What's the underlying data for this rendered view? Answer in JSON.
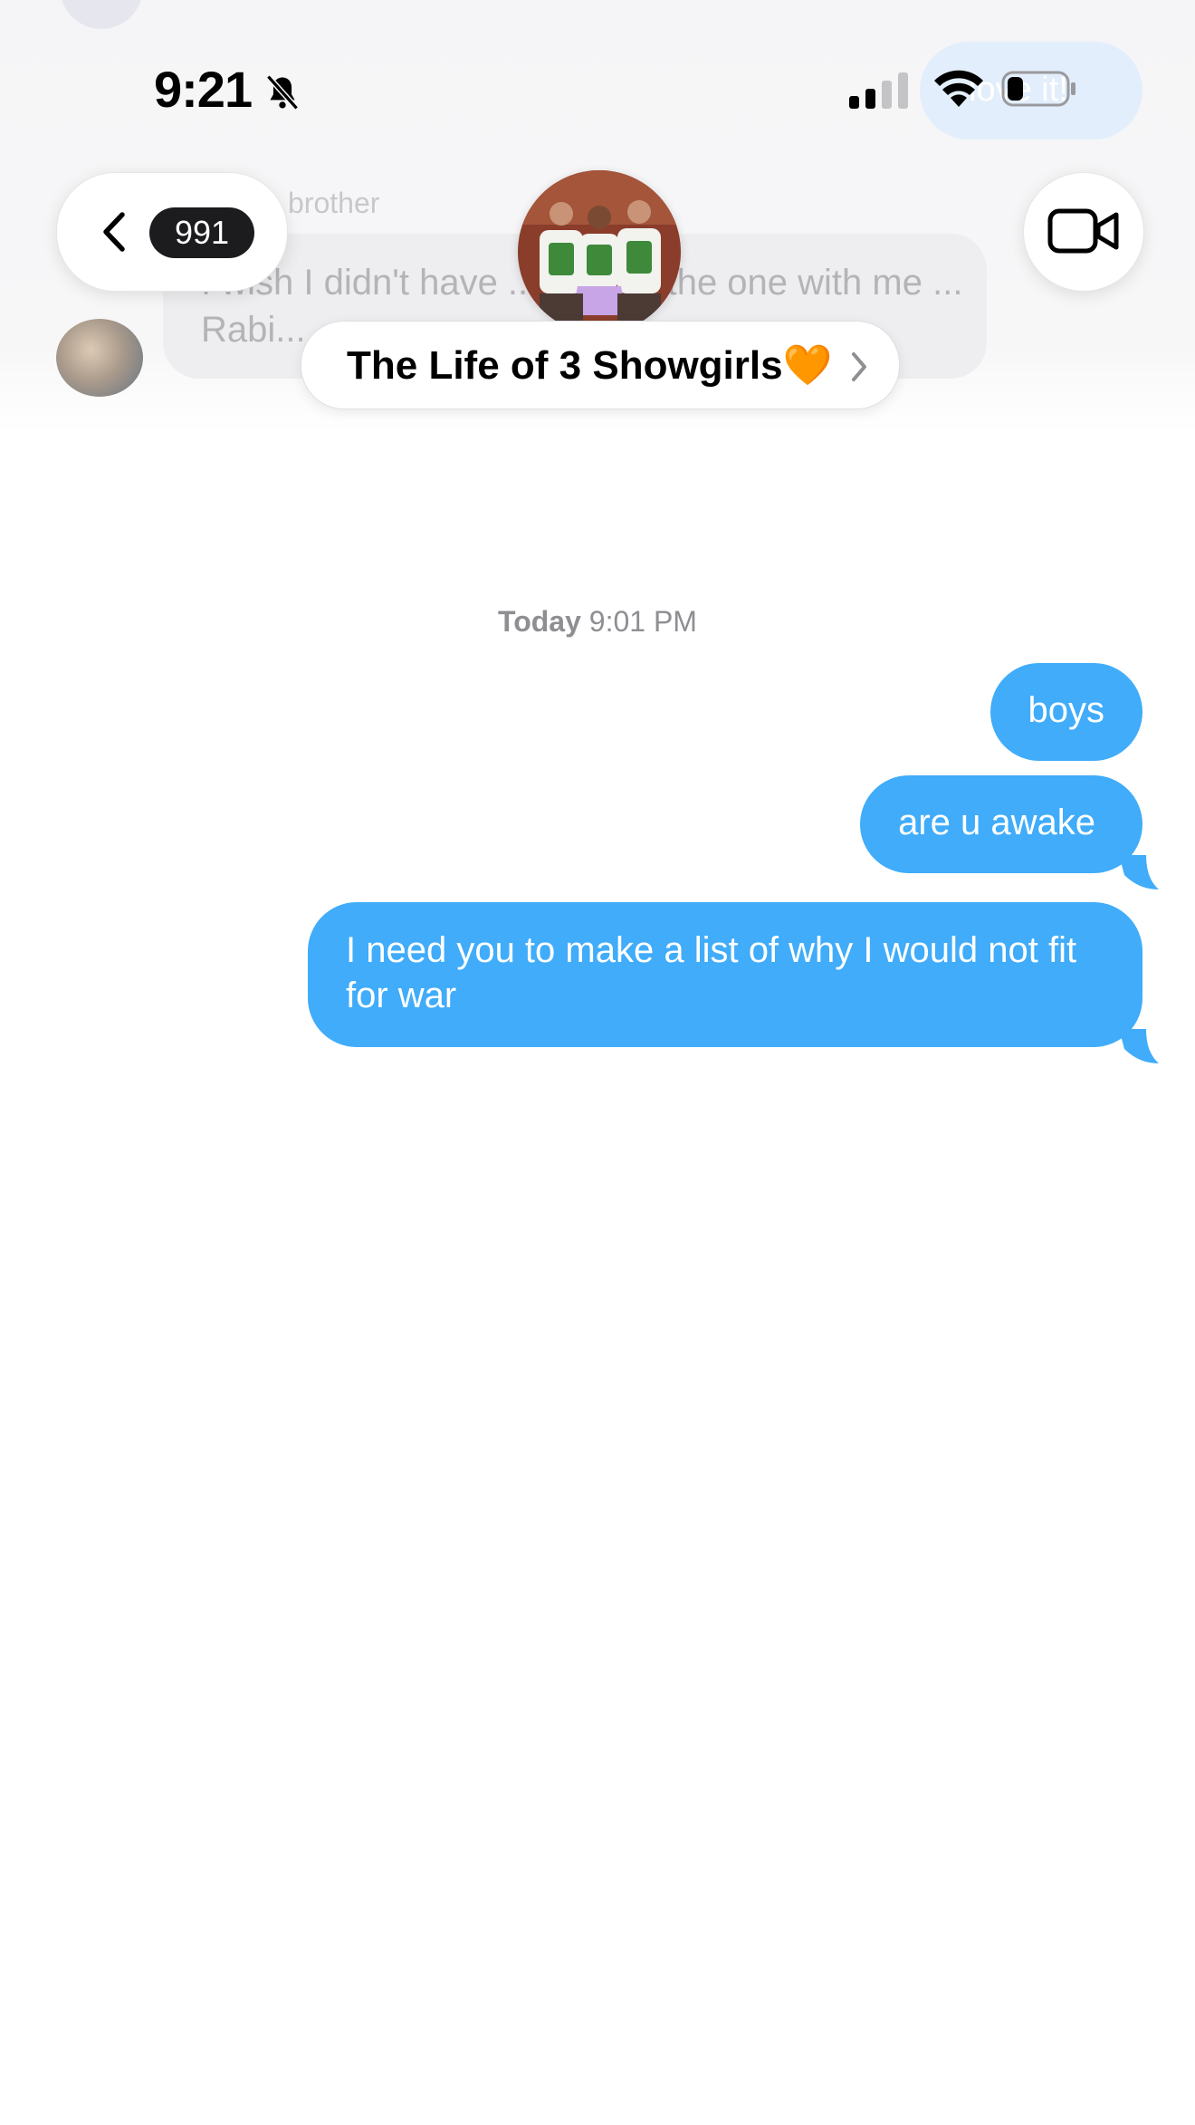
{
  "status_bar": {
    "time": "9:21"
  },
  "background_ghost": {
    "sender_name": "brother",
    "message_text": "I wish I didn't have ... es and the one with me ... Rabi...",
    "outgoing_snippet": "love it!"
  },
  "nav": {
    "back_badge": "991",
    "chat_title": "The Life of 3 Showgirls🧡"
  },
  "conversation": {
    "timestamp_day": "Today",
    "timestamp_time": "9:01 PM",
    "messages": [
      {
        "text": "boys",
        "direction": "outgoing"
      },
      {
        "text": "are u awake",
        "direction": "outgoing"
      },
      {
        "text": "I need you to make a list of why I would not fit for war",
        "direction": "outgoing"
      }
    ]
  },
  "colors": {
    "outgoing_bubble": "#40acfa",
    "badge_bg": "#1c1c1e",
    "timestamp": "#8e8e93"
  },
  "icons": [
    "bell-slash-icon",
    "cellular-signal-icon",
    "wifi-icon",
    "battery-icon",
    "chevron-left-icon",
    "video-camera-icon",
    "chevron-right-icon"
  ]
}
